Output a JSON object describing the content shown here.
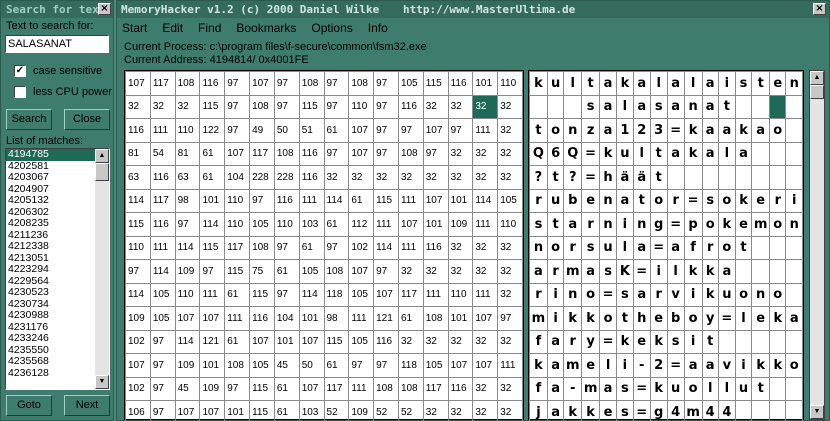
{
  "search_window": {
    "title": "Search for text",
    "close_glyph": "×",
    "prompt_label": "Text to search for:",
    "search_value": "SALASANAT",
    "case_sensitive": {
      "label": "case sensitive",
      "checked": true,
      "mark": "✓"
    },
    "less_cpu": {
      "label": "less CPU power",
      "checked": false
    },
    "search_button": "Search",
    "close_button": "Close",
    "matches_label": "List of matches:",
    "matches": [
      "4194785",
      "4202581",
      "4203067",
      "4204907",
      "4205132",
      "4206302",
      "4208235",
      "4211236",
      "4212338",
      "4213051",
      "4223294",
      "4229564",
      "4230523",
      "4230734",
      "4230988",
      "4231176",
      "4233246",
      "4235550",
      "4235568",
      "4236128"
    ],
    "selected_index": 0,
    "goto_button": "Goto",
    "next_button": "Next"
  },
  "main_window": {
    "title": "MemoryHacker v1.2 (c) 2000 Daniel Wilke",
    "url": "http://www.MasterUltima.de",
    "close_glyph": "×",
    "menu": [
      "Start",
      "Edit",
      "Find",
      "Bookmarks",
      "Options",
      "Info"
    ],
    "current_process": "Current Process: c:\\program files\\f-secure\\common\\fsm32.exe",
    "current_address": "Current Address: 4194814/ 0x4001FE",
    "highlight": {
      "row": 1,
      "col": 14
    },
    "hex_rows": [
      [
        "107",
        "117",
        "108",
        "116",
        "97",
        "107",
        "97",
        "108",
        "97",
        "108",
        "97",
        "105",
        "115",
        "116",
        "101",
        "110"
      ],
      [
        "32",
        "32",
        "32",
        "115",
        "97",
        "108",
        "97",
        "115",
        "97",
        "110",
        "97",
        "116",
        "32",
        "32",
        "32",
        "32"
      ],
      [
        "116",
        "111",
        "110",
        "122",
        "97",
        "49",
        "50",
        "51",
        "61",
        "107",
        "97",
        "97",
        "107",
        "97",
        "111",
        "32"
      ],
      [
        "81",
        "54",
        "81",
        "61",
        "107",
        "117",
        "108",
        "116",
        "97",
        "107",
        "97",
        "108",
        "97",
        "32",
        "32",
        "32"
      ],
      [
        "63",
        "116",
        "63",
        "61",
        "104",
        "228",
        "228",
        "116",
        "32",
        "32",
        "32",
        "32",
        "32",
        "32",
        "32",
        "32"
      ],
      [
        "114",
        "117",
        "98",
        "101",
        "110",
        "97",
        "116",
        "111",
        "114",
        "61",
        "115",
        "111",
        "107",
        "101",
        "114",
        "105"
      ],
      [
        "115",
        "116",
        "97",
        "114",
        "110",
        "105",
        "110",
        "103",
        "61",
        "112",
        "111",
        "107",
        "101",
        "109",
        "111",
        "110"
      ],
      [
        "110",
        "111",
        "114",
        "115",
        "117",
        "108",
        "97",
        "61",
        "97",
        "102",
        "114",
        "111",
        "116",
        "32",
        "32",
        "32"
      ],
      [
        "97",
        "114",
        "109",
        "97",
        "115",
        "75",
        "61",
        "105",
        "108",
        "107",
        "97",
        "32",
        "32",
        "32",
        "32",
        "32"
      ],
      [
        "114",
        "105",
        "110",
        "111",
        "61",
        "115",
        "97",
        "114",
        "118",
        "105",
        "107",
        "117",
        "111",
        "110",
        "111",
        "32"
      ],
      [
        "109",
        "105",
        "107",
        "107",
        "111",
        "116",
        "104",
        "101",
        "98",
        "111",
        "121",
        "61",
        "108",
        "101",
        "107",
        "97"
      ],
      [
        "102",
        "97",
        "114",
        "121",
        "61",
        "107",
        "101",
        "107",
        "115",
        "105",
        "116",
        "32",
        "32",
        "32",
        "32",
        "32"
      ],
      [
        "107",
        "97",
        "109",
        "101",
        "108",
        "105",
        "45",
        "50",
        "61",
        "97",
        "97",
        "118",
        "105",
        "107",
        "107",
        "111"
      ],
      [
        "102",
        "97",
        "45",
        "109",
        "97",
        "115",
        "61",
        "107",
        "117",
        "111",
        "108",
        "108",
        "117",
        "116",
        "32",
        "32"
      ],
      [
        "106",
        "97",
        "107",
        "107",
        "101",
        "115",
        "61",
        "103",
        "52",
        "109",
        "52",
        "52",
        "32",
        "32",
        "32",
        "32"
      ]
    ],
    "char_rows": [
      [
        "k",
        "u",
        "l",
        "t",
        "a",
        "k",
        "a",
        "l",
        "a",
        "l",
        "a",
        "i",
        "s",
        "t",
        "e",
        "n"
      ],
      [
        "",
        "",
        "",
        "s",
        "a",
        "l",
        "a",
        "s",
        "a",
        "n",
        "a",
        "t",
        "",
        "",
        "",
        ""
      ],
      [
        "t",
        "o",
        "n",
        "z",
        "a",
        "1",
        "2",
        "3",
        "=",
        "k",
        "a",
        "a",
        "k",
        "a",
        "o",
        ""
      ],
      [
        "Q",
        "6",
        "Q",
        "=",
        "k",
        "u",
        "l",
        "t",
        "a",
        "k",
        "a",
        "l",
        "a",
        "",
        "",
        ""
      ],
      [
        "?",
        "t",
        "?",
        "=",
        "h",
        "ä",
        "ä",
        "t",
        "",
        "",
        "",
        "",
        "",
        "",
        "",
        ""
      ],
      [
        "r",
        "u",
        "b",
        "e",
        "n",
        "a",
        "t",
        "o",
        "r",
        "=",
        "s",
        "o",
        "k",
        "e",
        "r",
        "i"
      ],
      [
        "s",
        "t",
        "a",
        "r",
        "n",
        "i",
        "n",
        "g",
        "=",
        "p",
        "o",
        "k",
        "e",
        "m",
        "o",
        "n"
      ],
      [
        "n",
        "o",
        "r",
        "s",
        "u",
        "l",
        "a",
        "=",
        "a",
        "f",
        "r",
        "o",
        "t",
        "",
        "",
        ""
      ],
      [
        "a",
        "r",
        "m",
        "a",
        "s",
        "K",
        "=",
        "i",
        "l",
        "k",
        "k",
        "a",
        "",
        "",
        "",
        ""
      ],
      [
        "r",
        "i",
        "n",
        "o",
        "=",
        "s",
        "a",
        "r",
        "v",
        "i",
        "k",
        "u",
        "o",
        "n",
        "o",
        ""
      ],
      [
        "m",
        "i",
        "k",
        "k",
        "o",
        "t",
        "h",
        "e",
        "b",
        "o",
        "y",
        "=",
        "l",
        "e",
        "k",
        "a"
      ],
      [
        "f",
        "a",
        "r",
        "y",
        "=",
        "k",
        "e",
        "k",
        "s",
        "i",
        "t",
        "",
        "",
        "",
        "",
        ""
      ],
      [
        "k",
        "a",
        "m",
        "e",
        "l",
        "i",
        "-",
        "2",
        "=",
        "a",
        "a",
        "v",
        "i",
        "k",
        "k",
        "o"
      ],
      [
        "f",
        "a",
        "-",
        "m",
        "a",
        "s",
        "=",
        "k",
        "u",
        "o",
        "l",
        "l",
        "u",
        "t",
        "",
        ""
      ],
      [
        "j",
        "a",
        "k",
        "k",
        "e",
        "s",
        "=",
        "g",
        "4",
        "m",
        "4",
        "4",
        "",
        "",
        "",
        ""
      ]
    ]
  }
}
